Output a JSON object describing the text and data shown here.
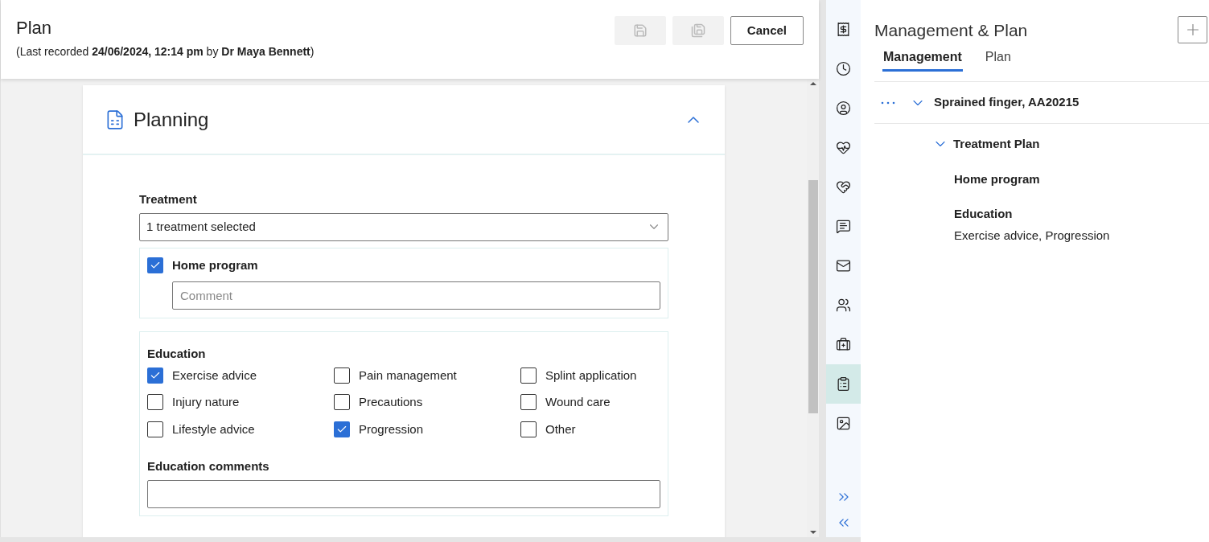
{
  "header": {
    "title": "Plan",
    "subtitle": "(Last recorded **24/06/2024, 12:14 pm** by **Dr Maya Bennett**)",
    "buttons": [
      {
        "kind": "save",
        "disabled": true
      },
      {
        "kind": "save-copy",
        "disabled": true
      },
      {
        "kind": "text",
        "label": "Cancel",
        "disabled": false
      }
    ]
  },
  "section": {
    "title": "Planning",
    "expanded": true,
    "treatment": {
      "label": "Treatment",
      "value": "1 treatment selected",
      "options": [
        {
          "label": "Home program",
          "checked": true,
          "comment_placeholder": "Comment"
        }
      ]
    },
    "education": {
      "label": "Education",
      "options": [
        {
          "label": "Exercise advice",
          "checked": true
        },
        {
          "label": "Pain management",
          "checked": false
        },
        {
          "label": "Splint application",
          "checked": false
        },
        {
          "label": "Injury nature",
          "checked": false
        },
        {
          "label": "Precautions",
          "checked": false
        },
        {
          "label": "Wound care",
          "checked": false
        },
        {
          "label": "Lifestyle advice",
          "checked": false
        },
        {
          "label": "Progression",
          "checked": true
        },
        {
          "label": "Other",
          "checked": false
        }
      ],
      "comments_label": "Education comments"
    }
  },
  "rail": [
    {
      "selected": false
    },
    {
      "selected": false
    },
    {
      "selected": false
    },
    {
      "selected": false
    },
    {
      "selected": false
    },
    {
      "selected": false
    },
    {
      "selected": false
    },
    {
      "selected": false
    },
    {
      "selected": false
    },
    {
      "selected": true
    },
    {
      "selected": false
    }
  ],
  "panel": {
    "title": "Management & Plan",
    "tabs": [
      {
        "label": "Management",
        "selected": true
      },
      {
        "label": "Plan",
        "selected": false
      }
    ],
    "condition": {
      "title": "Sprained finger, AA20215",
      "expanded": true,
      "groups": [
        {
          "title": "Treatment Plan",
          "expanded": true,
          "items": [
            {
              "title": "Home program"
            },
            {
              "title": "Education",
              "detail": "Exercise advice, Progression"
            }
          ]
        }
      ]
    }
  }
}
